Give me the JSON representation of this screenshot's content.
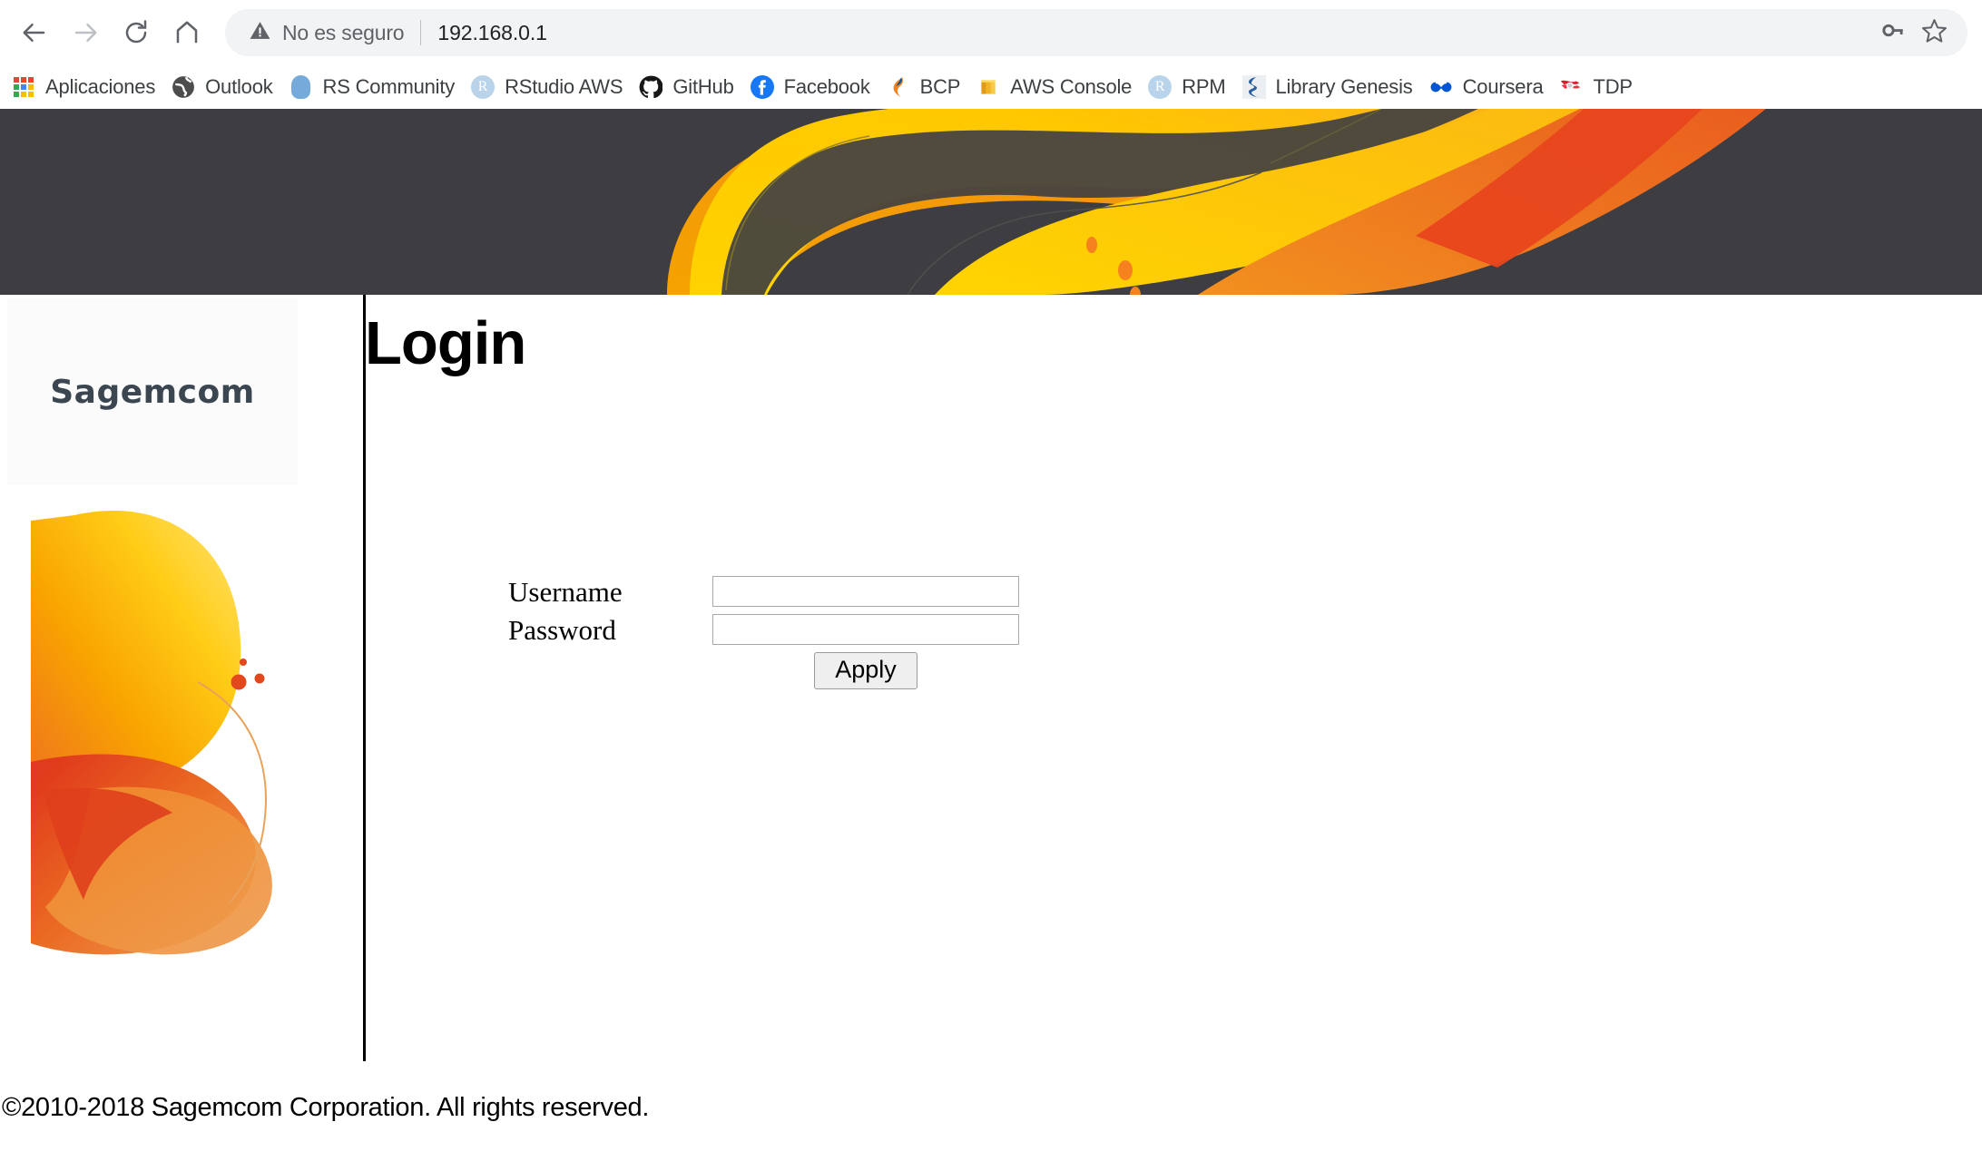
{
  "browser": {
    "nav": {
      "back_icon": "arrow-left-icon",
      "forward_icon": "arrow-right-icon",
      "reload_icon": "reload-icon",
      "home_icon": "home-icon"
    },
    "omnibox": {
      "warning_icon": "warning-triangle-icon",
      "security_text": "No es seguro",
      "url": "192.168.0.1",
      "key_icon": "key-icon",
      "star_icon": "star-outline-icon"
    },
    "bookmarks": [
      {
        "label": "Aplicaciones",
        "icon": "apps-grid-icon"
      },
      {
        "label": "Outlook",
        "icon": "outlook-globe-icon"
      },
      {
        "label": "RS Community",
        "icon": "rs-community-icon"
      },
      {
        "label": "RStudio AWS",
        "icon": "rstudio-r-icon"
      },
      {
        "label": "GitHub",
        "icon": "github-octocat-icon"
      },
      {
        "label": "Facebook",
        "icon": "facebook-f-icon"
      },
      {
        "label": "BCP",
        "icon": "bcp-swoosh-icon"
      },
      {
        "label": "AWS Console",
        "icon": "aws-cube-icon"
      },
      {
        "label": "RPM",
        "icon": "rstudio-r-icon"
      },
      {
        "label": "Library Genesis",
        "icon": "library-genesis-icon"
      },
      {
        "label": "Coursera",
        "icon": "coursera-infinity-icon"
      },
      {
        "label": "TDP",
        "icon": "tdp-flag-icon"
      }
    ]
  },
  "page": {
    "brand": "Sagemcom",
    "title": "Login",
    "banner_bg": "#3d3d42",
    "form": {
      "username_label": "Username",
      "username_value": "",
      "username_placeholder": "",
      "password_label": "Password",
      "password_value": "",
      "password_placeholder": "",
      "apply_label": "Apply"
    },
    "footer": {
      "copyright": "©2010-2018 Sagemcom Corporation. All rights reserved."
    },
    "colors": {
      "yellow": "#ffd200",
      "amber": "#f5a200",
      "orange": "#f07c1e",
      "deep_orange": "#e85620",
      "red_orange": "#e0401c",
      "dark": "#3d3d42"
    }
  }
}
